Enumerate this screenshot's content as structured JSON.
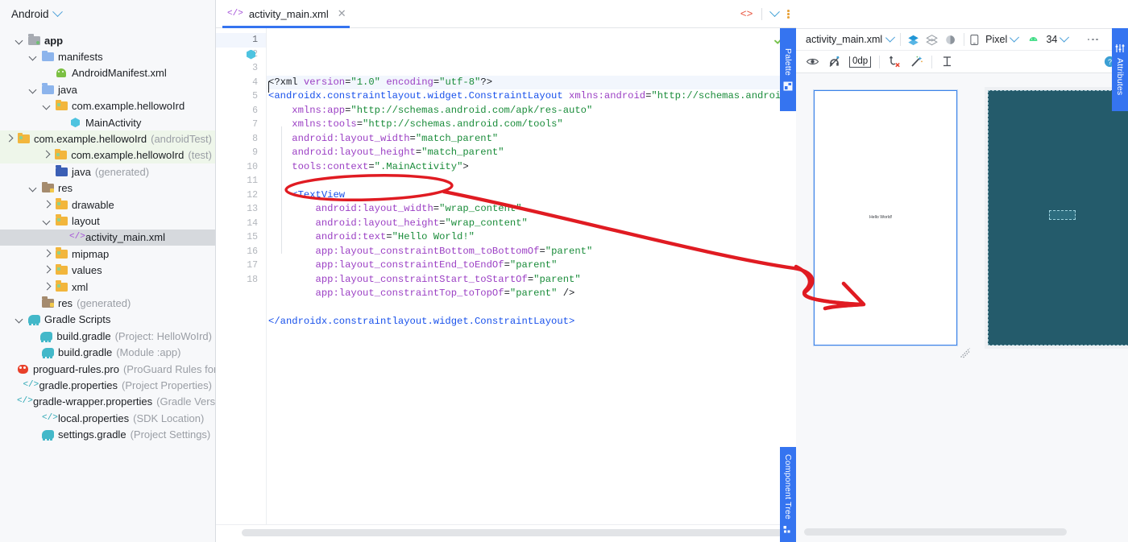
{
  "project": {
    "header_title": "Android",
    "header_dropdown_icon": "chevron-down-icon",
    "tree": [
      {
        "label": "app",
        "depth": 0,
        "arrow": "down",
        "icon": "folder-module",
        "suffix": "",
        "bold": true
      },
      {
        "label": "manifests",
        "depth": 1,
        "arrow": "down",
        "icon": "folder-blue",
        "suffix": ""
      },
      {
        "label": "AndroidManifest.xml",
        "depth": 2,
        "arrow": "none",
        "icon": "android-icon",
        "suffix": ""
      },
      {
        "label": "java",
        "depth": 1,
        "arrow": "down",
        "icon": "folder-blue",
        "suffix": ""
      },
      {
        "label": "com.example.hellowoIrd",
        "depth": 2,
        "arrow": "down",
        "icon": "folder-package",
        "suffix": ""
      },
      {
        "label": "MainActivity",
        "depth": 3,
        "arrow": "none",
        "icon": "class-icon",
        "suffix": ""
      },
      {
        "label": "com.example.hellowoIrd",
        "depth": 2,
        "arrow": "right",
        "icon": "folder-package",
        "suffix": "(androidTest)",
        "highlight": "green"
      },
      {
        "label": "com.example.hellowoIrd",
        "depth": 2,
        "arrow": "right",
        "icon": "folder-package",
        "suffix": "(test)",
        "highlight": "green"
      },
      {
        "label": "java",
        "depth": 2,
        "arrow": "none",
        "icon": "folder-generated",
        "suffix": "(generated)"
      },
      {
        "label": "res",
        "depth": 1,
        "arrow": "down",
        "icon": "folder-res",
        "suffix": ""
      },
      {
        "label": "drawable",
        "depth": 2,
        "arrow": "right",
        "icon": "folder-package",
        "suffix": ""
      },
      {
        "label": "layout",
        "depth": 2,
        "arrow": "down",
        "icon": "folder-package",
        "suffix": ""
      },
      {
        "label": "activity_main.xml",
        "depth": 3,
        "arrow": "none",
        "icon": "xml-icon",
        "suffix": "",
        "selected": true
      },
      {
        "label": "mipmap",
        "depth": 2,
        "arrow": "right",
        "icon": "folder-package",
        "suffix": ""
      },
      {
        "label": "values",
        "depth": 2,
        "arrow": "right",
        "icon": "folder-package",
        "suffix": ""
      },
      {
        "label": "xml",
        "depth": 2,
        "arrow": "right",
        "icon": "folder-package",
        "suffix": ""
      },
      {
        "label": "res",
        "depth": 1,
        "arrow": "none",
        "icon": "folder-res",
        "suffix": "(generated)"
      },
      {
        "label": "Gradle Scripts",
        "depth": 0,
        "arrow": "down",
        "icon": "gradle-icon",
        "suffix": ""
      },
      {
        "label": "build.gradle",
        "depth": 1,
        "arrow": "none",
        "icon": "gradle-icon",
        "suffix": "(Project: HelloWoIrd)"
      },
      {
        "label": "build.gradle",
        "depth": 1,
        "arrow": "none",
        "icon": "gradle-icon",
        "suffix": "(Module :app)"
      },
      {
        "label": "proguard-rules.pro",
        "depth": 1,
        "arrow": "none",
        "icon": "proguard-icon",
        "suffix": "(ProGuard Rules for \""
      },
      {
        "label": "gradle.properties",
        "depth": 1,
        "arrow": "none",
        "icon": "properties-icon",
        "suffix": "(Project Properties)"
      },
      {
        "label": "gradle-wrapper.properties",
        "depth": 1,
        "arrow": "none",
        "icon": "properties-icon",
        "suffix": "(Gradle Versi"
      },
      {
        "label": "local.properties",
        "depth": 1,
        "arrow": "none",
        "icon": "properties-icon",
        "suffix": "(SDK Location)"
      },
      {
        "label": "settings.gradle",
        "depth": 1,
        "arrow": "none",
        "icon": "gradle-icon",
        "suffix": "(Project Settings)"
      }
    ]
  },
  "editor": {
    "tab": {
      "name": "activity_main.xml",
      "icon": "xml-icon",
      "close_icon": "close-icon"
    },
    "tab_tools": {
      "code_view_icon": "code-brackets-icon",
      "chevron_icon": "chevron-down-icon",
      "more_icon": "kebab-menu-icon"
    },
    "inspection_status_icon": "green-check-icon",
    "line_numbers": [
      "1",
      "2",
      "3",
      "4",
      "5",
      "6",
      "7",
      "8",
      "9",
      "10",
      "11",
      "12",
      "13",
      "14",
      "15",
      "16",
      "17",
      "18"
    ],
    "gutter_icon_line": 2,
    "gutter_icon": "layout-preview-icon",
    "lines": [
      [
        {
          "t": "<?xml ",
          "c": "plain"
        },
        {
          "t": "version",
          "c": "attr"
        },
        {
          "t": "=",
          "c": "plain"
        },
        {
          "t": "\"1.0\"",
          "c": "val"
        },
        {
          "t": " ",
          "c": "plain"
        },
        {
          "t": "encoding",
          "c": "attr"
        },
        {
          "t": "=",
          "c": "plain"
        },
        {
          "t": "\"utf-8\"",
          "c": "val"
        },
        {
          "t": "?>",
          "c": "plain"
        }
      ],
      [
        {
          "t": "<androidx.constraintlayout.widget.ConstraintLayout ",
          "c": "tag"
        },
        {
          "t": "xmlns:android",
          "c": "attr"
        },
        {
          "t": "=",
          "c": "plain"
        },
        {
          "t": "\"http://schemas.android.com/apk/res/android",
          "c": "val"
        }
      ],
      [
        {
          "t": "    xmlns:app",
          "c": "attr"
        },
        {
          "t": "=",
          "c": "plain"
        },
        {
          "t": "\"http://schemas.android.com/apk/res-auto\"",
          "c": "val"
        }
      ],
      [
        {
          "t": "    xmlns:tools",
          "c": "attr"
        },
        {
          "t": "=",
          "c": "plain"
        },
        {
          "t": "\"http://schemas.android.com/tools\"",
          "c": "val"
        }
      ],
      [
        {
          "t": "    android:layout_width",
          "c": "attr"
        },
        {
          "t": "=",
          "c": "plain"
        },
        {
          "t": "\"match_parent\"",
          "c": "val"
        }
      ],
      [
        {
          "t": "    android:layout_height",
          "c": "attr"
        },
        {
          "t": "=",
          "c": "plain"
        },
        {
          "t": "\"match_parent\"",
          "c": "val"
        }
      ],
      [
        {
          "t": "    tools:context",
          "c": "attr"
        },
        {
          "t": "=",
          "c": "plain"
        },
        {
          "t": "\".MainActivity\"",
          "c": "val"
        },
        {
          "t": ">",
          "c": "plain"
        }
      ],
      [],
      [
        {
          "t": "    <TextView",
          "c": "tag"
        }
      ],
      [
        {
          "t": "        android:layout_width",
          "c": "attr"
        },
        {
          "t": "=",
          "c": "plain"
        },
        {
          "t": "\"wrap_content\"",
          "c": "val"
        }
      ],
      [
        {
          "t": "        android:layout_height",
          "c": "attr"
        },
        {
          "t": "=",
          "c": "plain"
        },
        {
          "t": "\"wrap_content\"",
          "c": "val"
        }
      ],
      [
        {
          "t": "        android:text",
          "c": "attr"
        },
        {
          "t": "=",
          "c": "plain"
        },
        {
          "t": "\"Hello World!\"",
          "c": "val"
        }
      ],
      [
        {
          "t": "        app:layout_constraintBottom_toBottomOf",
          "c": "attr"
        },
        {
          "t": "=",
          "c": "plain"
        },
        {
          "t": "\"parent\"",
          "c": "val"
        }
      ],
      [
        {
          "t": "        app:layout_constraintEnd_toEndOf",
          "c": "attr"
        },
        {
          "t": "=",
          "c": "plain"
        },
        {
          "t": "\"parent\"",
          "c": "val"
        }
      ],
      [
        {
          "t": "        app:layout_constraintStart_toStartOf",
          "c": "attr"
        },
        {
          "t": "=",
          "c": "plain"
        },
        {
          "t": "\"parent\"",
          "c": "val"
        }
      ],
      [
        {
          "t": "        app:layout_constraintTop_toTopOf",
          "c": "attr"
        },
        {
          "t": "=",
          "c": "plain"
        },
        {
          "t": "\"parent\"",
          "c": "val"
        },
        {
          "t": " />",
          "c": "plain"
        }
      ],
      [],
      [
        {
          "t": "</androidx.constraintlayout.widget.ConstraintLayout>",
          "c": "tag"
        }
      ]
    ]
  },
  "palette_strip": {
    "label": "Palette",
    "icon": "palette-icon"
  },
  "component_tree_strip": {
    "label": "Component Tree",
    "icon": "tree-icon"
  },
  "attributes_strip": {
    "label": "Attributes",
    "icon": "sliders-icon"
  },
  "design": {
    "toolbar1": {
      "file_label": "activity_main.xml",
      "file_dropdown_icon": "chevron-down-icon",
      "design_mode_icon": "layers-icon",
      "blueprint_mode_icon": "blueprint-icon",
      "both_mode_icon": "design-blueprint-icon",
      "device_icon": "phone-icon",
      "device_label": "Pixel",
      "device_dropdown_icon": "chevron-down-icon",
      "api_icon": "android-icon",
      "api_label": "34",
      "api_dropdown_icon": "chevron-down-icon",
      "overflow_icon": "ellipsis-icon",
      "issues_icon": "warning-circle-icon"
    },
    "toolbar2": {
      "view_options_icon": "eye-icon",
      "autoconnect_icon": "magnet-off-icon",
      "margin_value": "0dp",
      "clear_constraints_icon": "clear-constraints-icon",
      "infer_constraints_icon": "magic-wand-icon",
      "baseline_icon": "baseline-icon",
      "help_icon": "help-circle-icon"
    },
    "preview": {
      "text_view_label": "Hello World!",
      "resize_handle_icon": "resize-grip-icon"
    }
  },
  "annotation": {
    "type": "red-ink-arrow",
    "ellipse_target": "android:text=\"Hello World!\"",
    "color": "#e01b22"
  }
}
